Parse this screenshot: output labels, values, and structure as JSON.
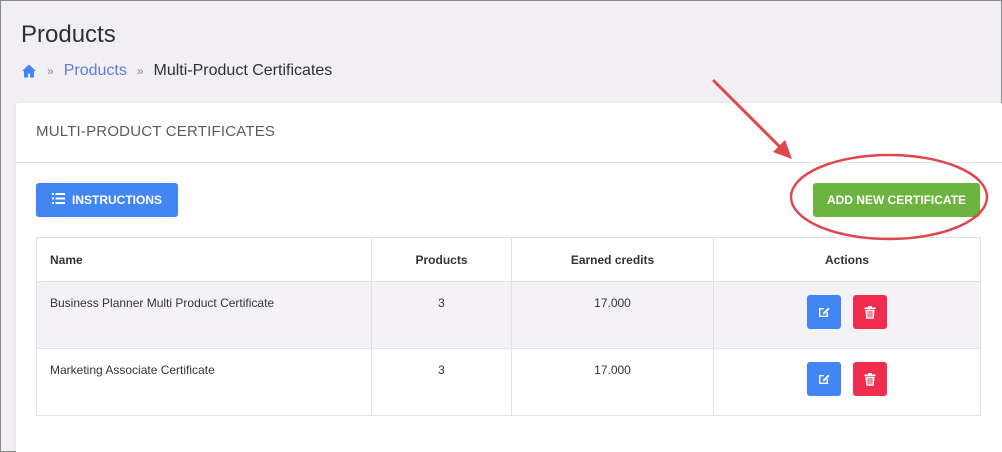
{
  "header": {
    "title": "Products",
    "breadcrumb": {
      "home_icon": "home-icon",
      "separator": "»",
      "link": "Products",
      "current": "Multi-Product Certificates"
    }
  },
  "card": {
    "title": "MULTI-PRODUCT CERTIFICATES",
    "instructions_label": "INSTRUCTIONS",
    "add_label": "ADD NEW CERTIFICATE"
  },
  "table": {
    "columns": [
      "Name",
      "Products",
      "Earned credits",
      "Actions"
    ],
    "rows": [
      {
        "name": "Business Planner Multi Product Certificate",
        "products": "3",
        "credits": "17.000"
      },
      {
        "name": "Marketing Associate Certificate",
        "products": "3",
        "credits": "17.000"
      }
    ]
  },
  "colors": {
    "primary": "#4285f4",
    "success": "#6db33f",
    "danger": "#ef2d4f",
    "annotation": "#e0464c"
  }
}
